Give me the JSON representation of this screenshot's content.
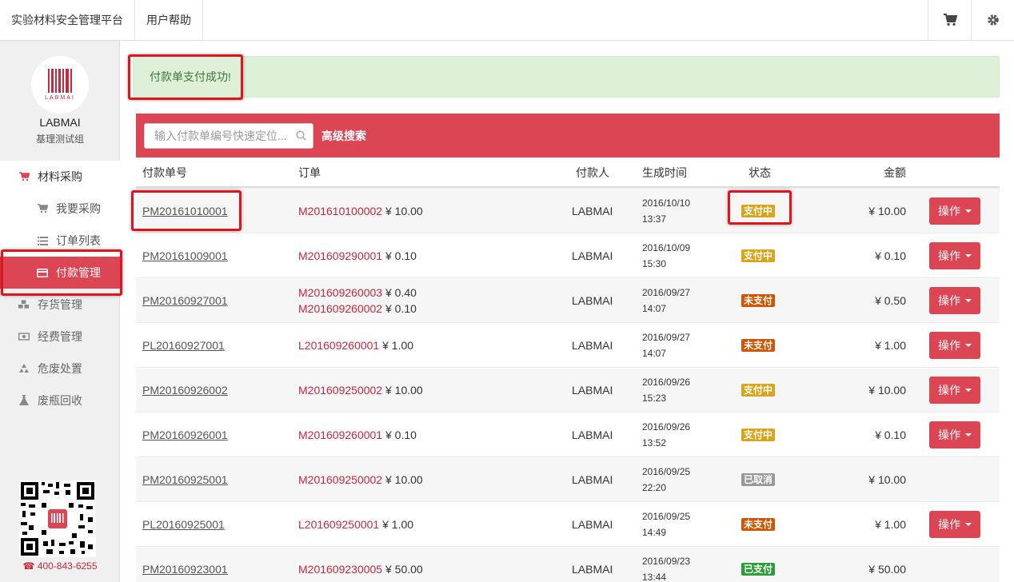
{
  "topbar": {
    "brand": "实验材料安全管理平台",
    "help": "用户帮助",
    "cart_icon": "cart-icon",
    "settings_icon": "gear-icon"
  },
  "sidebar": {
    "logo_text": "LABMAI",
    "name": "LABMAI",
    "group": "基理测试组",
    "nav": [
      {
        "label": "材料采购",
        "icon": "cart-icon"
      },
      {
        "label": "我要采购",
        "icon": "cart-icon"
      },
      {
        "label": "订单列表",
        "icon": "list-icon"
      },
      {
        "label": "付款管理",
        "icon": "card-icon"
      }
    ],
    "nav_lower": [
      {
        "label": "存货管理",
        "icon": "cubes-icon"
      },
      {
        "label": "经费管理",
        "icon": "money-icon"
      },
      {
        "label": "危废处置",
        "icon": "recycle-icon"
      },
      {
        "label": "废瓶回收",
        "icon": "flask-icon"
      }
    ],
    "phone": "400-843-6255"
  },
  "alert": {
    "text": "付款单支付成功!"
  },
  "search": {
    "placeholder": "输入付款单编号快速定位...",
    "advanced": "高级搜索"
  },
  "table": {
    "headers": {
      "id": "付款单号",
      "order": "订单",
      "payer": "付款人",
      "time": "生成时间",
      "status": "状态",
      "amount": "金额"
    },
    "op_label": "操作",
    "status_colors": {
      "支付中": "#d9a31a",
      "未支付": "#d35400",
      "已取消": "#999999",
      "已支付": "#2a9d3a"
    },
    "rows": [
      {
        "id": "PM20161010001",
        "orders": [
          {
            "code": "M201610100002",
            "amt": "¥ 10.00"
          }
        ],
        "payer": "LABMAI",
        "date": "2016/10/10",
        "time": "13:37",
        "status": "支付中",
        "amount": "¥ 10.00",
        "op": true
      },
      {
        "id": "PM20161009001",
        "orders": [
          {
            "code": "M201609290001",
            "amt": "¥ 0.10"
          }
        ],
        "payer": "LABMAI",
        "date": "2016/10/09",
        "time": "15:30",
        "status": "支付中",
        "amount": "¥ 0.10",
        "op": true
      },
      {
        "id": "PM20160927001",
        "orders": [
          {
            "code": "M201609260003",
            "amt": "¥ 0.40"
          },
          {
            "code": "M201609260002",
            "amt": "¥ 0.10"
          }
        ],
        "payer": "LABMAI",
        "date": "2016/09/27",
        "time": "14:07",
        "status": "未支付",
        "amount": "¥ 0.50",
        "op": true
      },
      {
        "id": "PL20160927001",
        "orders": [
          {
            "code": "L201609260001",
            "amt": "¥ 1.00"
          }
        ],
        "payer": "LABMAI",
        "date": "2016/09/27",
        "time": "14:07",
        "status": "未支付",
        "amount": "¥ 1.00",
        "op": true
      },
      {
        "id": "PM20160926002",
        "orders": [
          {
            "code": "M201609250002",
            "amt": "¥ 10.00"
          }
        ],
        "payer": "LABMAI",
        "date": "2016/09/26",
        "time": "15:23",
        "status": "支付中",
        "amount": "¥ 10.00",
        "op": true
      },
      {
        "id": "PM20160926001",
        "orders": [
          {
            "code": "M201609260001",
            "amt": "¥ 0.10"
          }
        ],
        "payer": "LABMAI",
        "date": "2016/09/26",
        "time": "13:52",
        "status": "支付中",
        "amount": "¥ 0.10",
        "op": true
      },
      {
        "id": "PM20160925001",
        "orders": [
          {
            "code": "M201609250002",
            "amt": "¥ 10.00"
          }
        ],
        "payer": "LABMAI",
        "date": "2016/09/25",
        "time": "22:20",
        "status": "已取消",
        "amount": "¥ 10.00",
        "op": false
      },
      {
        "id": "PL20160925001",
        "orders": [
          {
            "code": "L201609250001",
            "amt": "¥ 1.00"
          }
        ],
        "payer": "LABMAI",
        "date": "2016/09/25",
        "time": "14:49",
        "status": "未支付",
        "amount": "¥ 1.00",
        "op": true
      },
      {
        "id": "PM20160923001",
        "orders": [
          {
            "code": "M201609230005",
            "amt": "¥ 50.00"
          }
        ],
        "payer": "LABMAI",
        "date": "2016/09/23",
        "time": "13:44",
        "status": "已支付",
        "amount": "¥ 50.00",
        "op": false
      }
    ]
  }
}
